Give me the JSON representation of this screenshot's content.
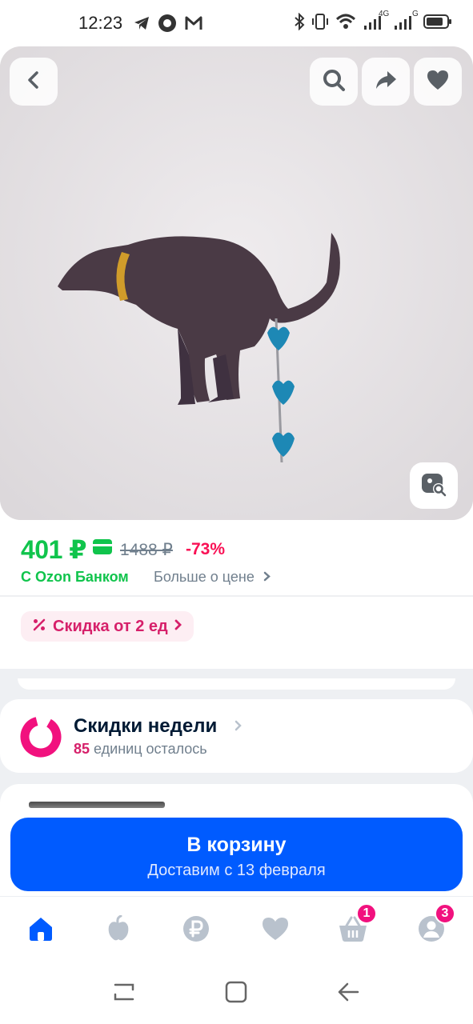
{
  "status_bar": {
    "time": "12:23",
    "left_icons": [
      "telegram-icon",
      "circle-app-icon",
      "gmail-icon"
    ],
    "right_icons": [
      "bluetooth-icon",
      "vibrate-icon",
      "wifi-icon",
      "signal-4g-icon",
      "signal-g-icon",
      "battery-icon"
    ],
    "network_1": "4G",
    "network_2": "G"
  },
  "photo": {
    "description_icons": [
      "back-icon",
      "search-icon",
      "share-icon",
      "heart-icon",
      "image-search-icon"
    ]
  },
  "price": {
    "current": "401 ₽",
    "old": "1488 ₽",
    "discount": "-73%",
    "bank_label": "С Ozon Банком",
    "more_label": "Больше о цене"
  },
  "discount_chip": {
    "label": "Скидка от 2 ед"
  },
  "weekly": {
    "title": "Скидки недели",
    "count": "85",
    "remaining": "единиц осталось"
  },
  "cart_button": {
    "title": "В корзину",
    "subtitle": "Доставим с 13 февраля"
  },
  "tabbar": {
    "items": [
      {
        "name": "home",
        "icon": "home-icon",
        "badge": ""
      },
      {
        "name": "fresh",
        "icon": "apple-icon",
        "badge": ""
      },
      {
        "name": "finance",
        "icon": "ruble-icon",
        "badge": ""
      },
      {
        "name": "favorites",
        "icon": "heart-icon",
        "badge": ""
      },
      {
        "name": "cart",
        "icon": "basket-icon",
        "badge": "1"
      },
      {
        "name": "profile",
        "icon": "profile-icon",
        "badge": "3"
      }
    ],
    "active_color": "#005bff",
    "inactive_color": "#b9c2cd"
  },
  "colors": {
    "price_green": "#10c44c",
    "discount_pink": "#f91155",
    "accent_blue": "#005bff",
    "badge_pink": "#f1117e"
  }
}
